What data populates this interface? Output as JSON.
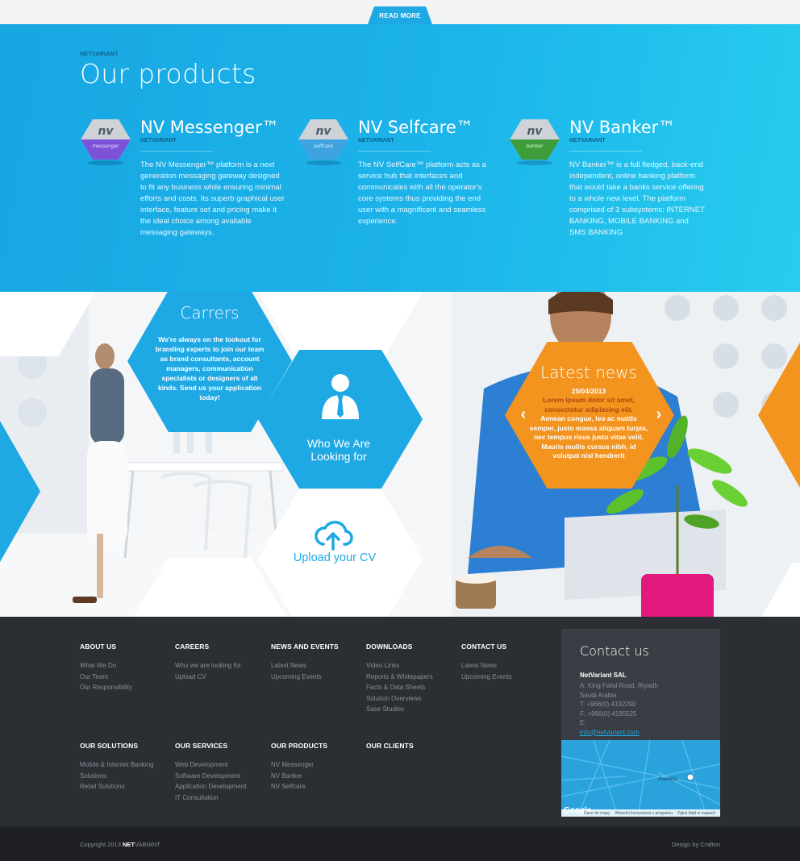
{
  "top": {
    "read_more": "READ MORE"
  },
  "products": {
    "eyebrow": "NETVARIANT",
    "title": "Our products",
    "items": [
      {
        "logo_text": "nv",
        "logo_sub": "messenger",
        "name": "NV Messenger™",
        "sub": "NETVARIANT",
        "description": "The NV Messenger™ platform is a next generation messaging gateway designed to fit any business while ensuring minimal efforts and costs. Its superb graphical user interface, feature set and pricing make it the ideal choice among available messaging gateways."
      },
      {
        "logo_text": "nv",
        "logo_sub": "selfcare",
        "name": "NV Selfcare™",
        "sub": "NETVARIANT",
        "description": "The NV SelfCare™ platform acts as a service hub that interfaces and communicates with all the operator's core systems thus providing the end user with a magnificent and seamless experience."
      },
      {
        "logo_text": "nv",
        "logo_sub": "banker",
        "name": "NV Banker™",
        "sub": "NETVARIANT",
        "description": "NV Banker™ is a full fledged, back-end independent, online banking platform that would take a banks service offering to a whole new level. The platform comprised of 3 subsystems: INTERNET BANKING, MOBILE BANKING and SMS BANKING"
      }
    ],
    "colors": {
      "messenger": "#7b52d8",
      "selfcare": "#3fa3e0",
      "banker": "#3f9c3a"
    }
  },
  "careers": {
    "title": "Carrers",
    "text": "We're always on the lookout for branding experts to join our team as brand consultants, account managers, communication specialists or designers of all kinds. Send us your application today!",
    "who": "Who We Are Looking for",
    "upload": "Upload your CV"
  },
  "news": {
    "title": "Latest news",
    "date": "25/04/2013",
    "lead": "Lorem ipsum dolor sit amet, consectetur adipiscing elit.",
    "body": "Aenean congue, leo ac mattis semper, justo massa aliquam turpis, nec tempus risus justo vitae velit. Mauris mollis cursus nibh, id volutpat nisl hendrerit",
    "prev": "‹",
    "next": "›"
  },
  "footer": {
    "columns_row1": [
      {
        "head": "ABOUT US",
        "links": [
          "What We Do",
          "Our Team",
          "Our Responsibility"
        ]
      },
      {
        "head": "CAREERS",
        "links": [
          "Who we are looking for",
          "Upload CV"
        ]
      },
      {
        "head": "NEWS AND EVENTS",
        "links": [
          "Latest News",
          "Upcoming Events"
        ]
      },
      {
        "head": "DOWNLOADS",
        "links": [
          "Video Links",
          "Reports & Whitepapers",
          "Facts & Data Sheets",
          "Solution Overviews",
          "Sase Studies"
        ]
      },
      {
        "head": "CONTACT US",
        "links": [
          "Latest News",
          "Upcoming Events"
        ]
      }
    ],
    "columns_row2": [
      {
        "head": "OUR SOLUTIONS",
        "links": [
          "Mobile & Internet Banking",
          "Solutions",
          "Retail Solutions"
        ]
      },
      {
        "head": "OUR SERVICES",
        "links": [
          "Web Development",
          "Software Development",
          "Application Development",
          "IT Consultation"
        ]
      },
      {
        "head": "OUR PRODUCTS",
        "links": [
          "NV Messenger",
          "NV Banker",
          "NV Selfcare"
        ]
      },
      {
        "head": "OUR CLIENTS",
        "links": []
      }
    ],
    "contact": {
      "title": "Contact us",
      "company": "NetVariant SAL",
      "address1": "A: King Fahd Road, Riyadh",
      "address2": "Saudi Arabia",
      "phone": "T: +966(0) 4192290",
      "fax": "F: +966(0) 4195525",
      "email_prefix": "E: ",
      "email": "info@netvariant.com"
    },
    "map": {
      "label": "Avenida",
      "google": "Google",
      "footer_items": [
        "Dane do mapy",
        "Warunki korzystania z programu",
        "Zgłoś błąd w mapach"
      ]
    }
  },
  "bottom": {
    "copyright_prefix": "Copyright 2013 ",
    "brand_bold": "NET",
    "brand_rest": "VARIANT",
    "design": "Design by Crafton"
  }
}
